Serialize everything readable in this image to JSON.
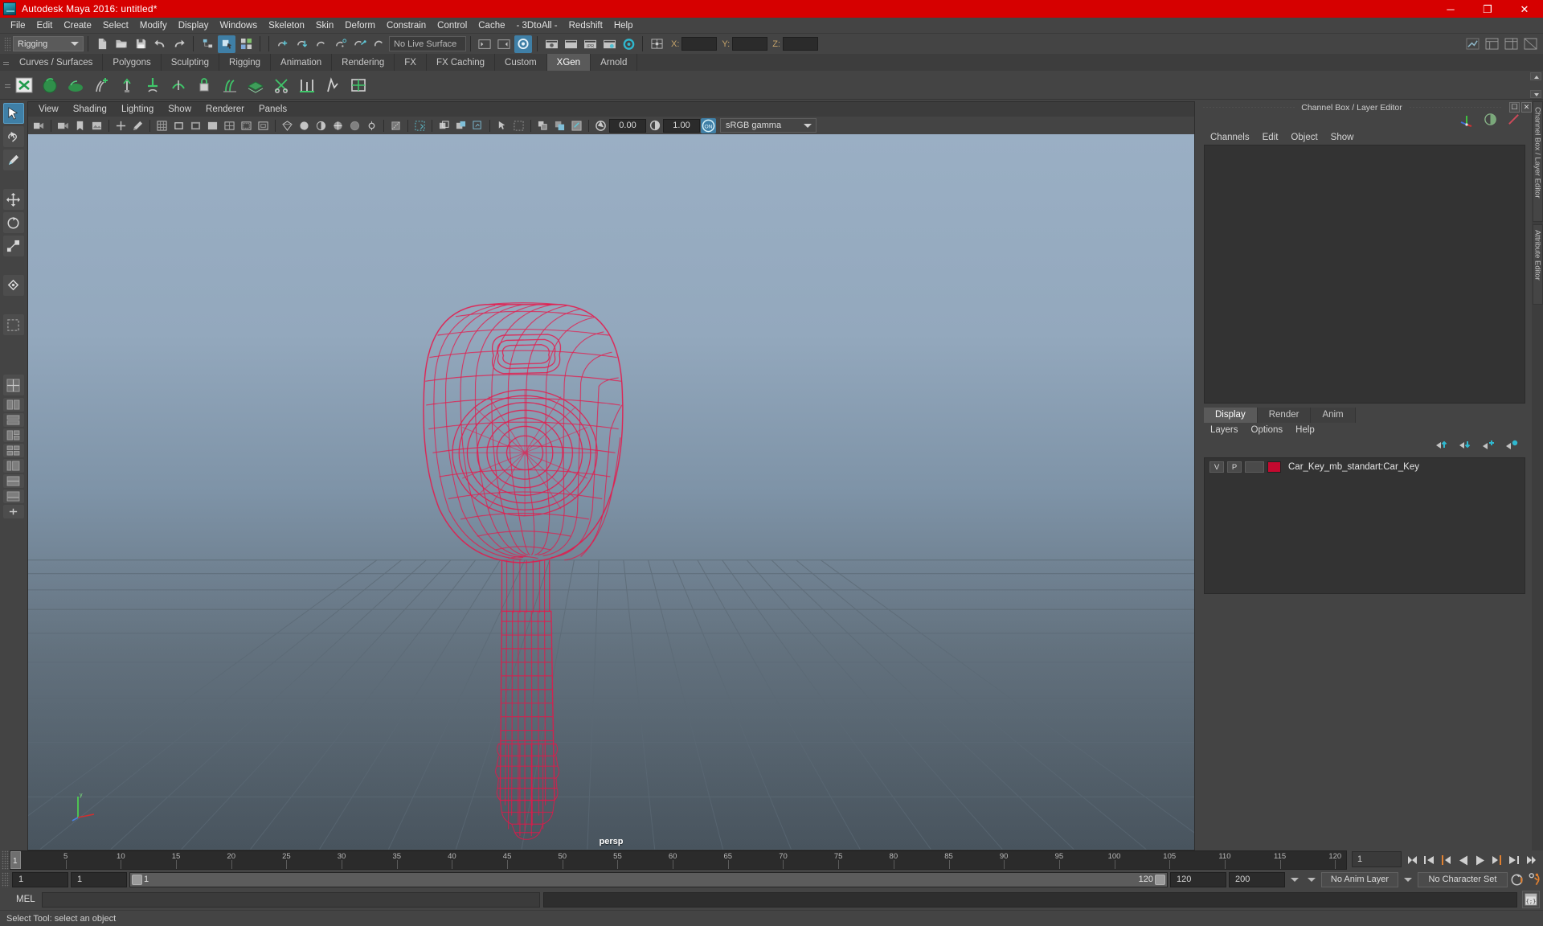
{
  "window": {
    "title": "Autodesk Maya 2016: untitled*",
    "logo_icon": "maya-logo-icon",
    "controls": [
      {
        "name": "minimize",
        "glyph": "─"
      },
      {
        "name": "maximize",
        "glyph": "❐"
      },
      {
        "name": "close",
        "glyph": "✕"
      }
    ]
  },
  "menubar": {
    "items": [
      "File",
      "Edit",
      "Create",
      "Select",
      "Modify",
      "Display",
      "Windows",
      "Skeleton",
      "Skin",
      "Deform",
      "Constrain",
      "Control",
      "Cache",
      "- 3DtoAll -",
      "Redshift",
      "Help"
    ]
  },
  "statusbar": {
    "mode": "Rigging",
    "live_surface": "No Live Surface",
    "coords": [
      {
        "label": "X:",
        "value": ""
      },
      {
        "label": "Y:",
        "value": ""
      },
      {
        "label": "Z:",
        "value": ""
      }
    ]
  },
  "shelf": {
    "tabs": [
      "Curves / Surfaces",
      "Polygons",
      "Sculpting",
      "Rigging",
      "Animation",
      "Rendering",
      "FX",
      "FX Caching",
      "Custom",
      "XGen",
      "Arnold"
    ],
    "active_tab": "XGen"
  },
  "viewport": {
    "menus": [
      "View",
      "Shading",
      "Lighting",
      "Show",
      "Renderer",
      "Panels"
    ],
    "exposure": "0.00",
    "gamma_value": "1.00",
    "color_management_toggle": "ON",
    "color_profile": "sRGB gamma",
    "camera_label": "persp",
    "wireframe_color": "#e8174a",
    "background_top": "#9aafc4",
    "background_bottom": "#4a5660"
  },
  "channel_box": {
    "panel_title": "Channel Box / Layer Editor",
    "menus": [
      "Channels",
      "Edit",
      "Object",
      "Show"
    ],
    "window_buttons": [
      "undock",
      "close"
    ]
  },
  "layer_editor": {
    "tabs": [
      "Display",
      "Render",
      "Anim"
    ],
    "active_tab": "Display",
    "menus": [
      "Layers",
      "Options",
      "Help"
    ],
    "layers": [
      {
        "visibility": "V",
        "playback": "P",
        "shading": "",
        "color": "#c4092f",
        "name": "Car_Key_mb_standart:Car_Key"
      }
    ]
  },
  "docked_tabs": [
    "Channel Box / Layer Editor",
    "Attribute Editor"
  ],
  "timeline": {
    "start_frame": "1",
    "current_frame": "1",
    "ticks": [
      5,
      10,
      15,
      20,
      25,
      30,
      35,
      40,
      45,
      50,
      55,
      60,
      65,
      70,
      75,
      80,
      85,
      90,
      95,
      100,
      105,
      110,
      115,
      120
    ],
    "frame_field": "1",
    "playback_buttons": [
      "go-to-start",
      "step-back-key",
      "step-back-frame",
      "play-backwards",
      "play-forwards",
      "step-forward-frame",
      "step-forward-key",
      "go-to-end"
    ]
  },
  "range_slider": {
    "range_start": "1",
    "anim_start": "1",
    "bar_start_label": "1",
    "bar_end_label": "120",
    "anim_end": "120",
    "range_end": "200",
    "anim_layer": "No Anim Layer",
    "character_set": "No Character Set"
  },
  "command_line": {
    "language_label": "MEL",
    "input_value": "",
    "output_value": "",
    "script_editor_icon": "script-editor-icon"
  },
  "help_line": {
    "text": "Select Tool: select an object"
  }
}
